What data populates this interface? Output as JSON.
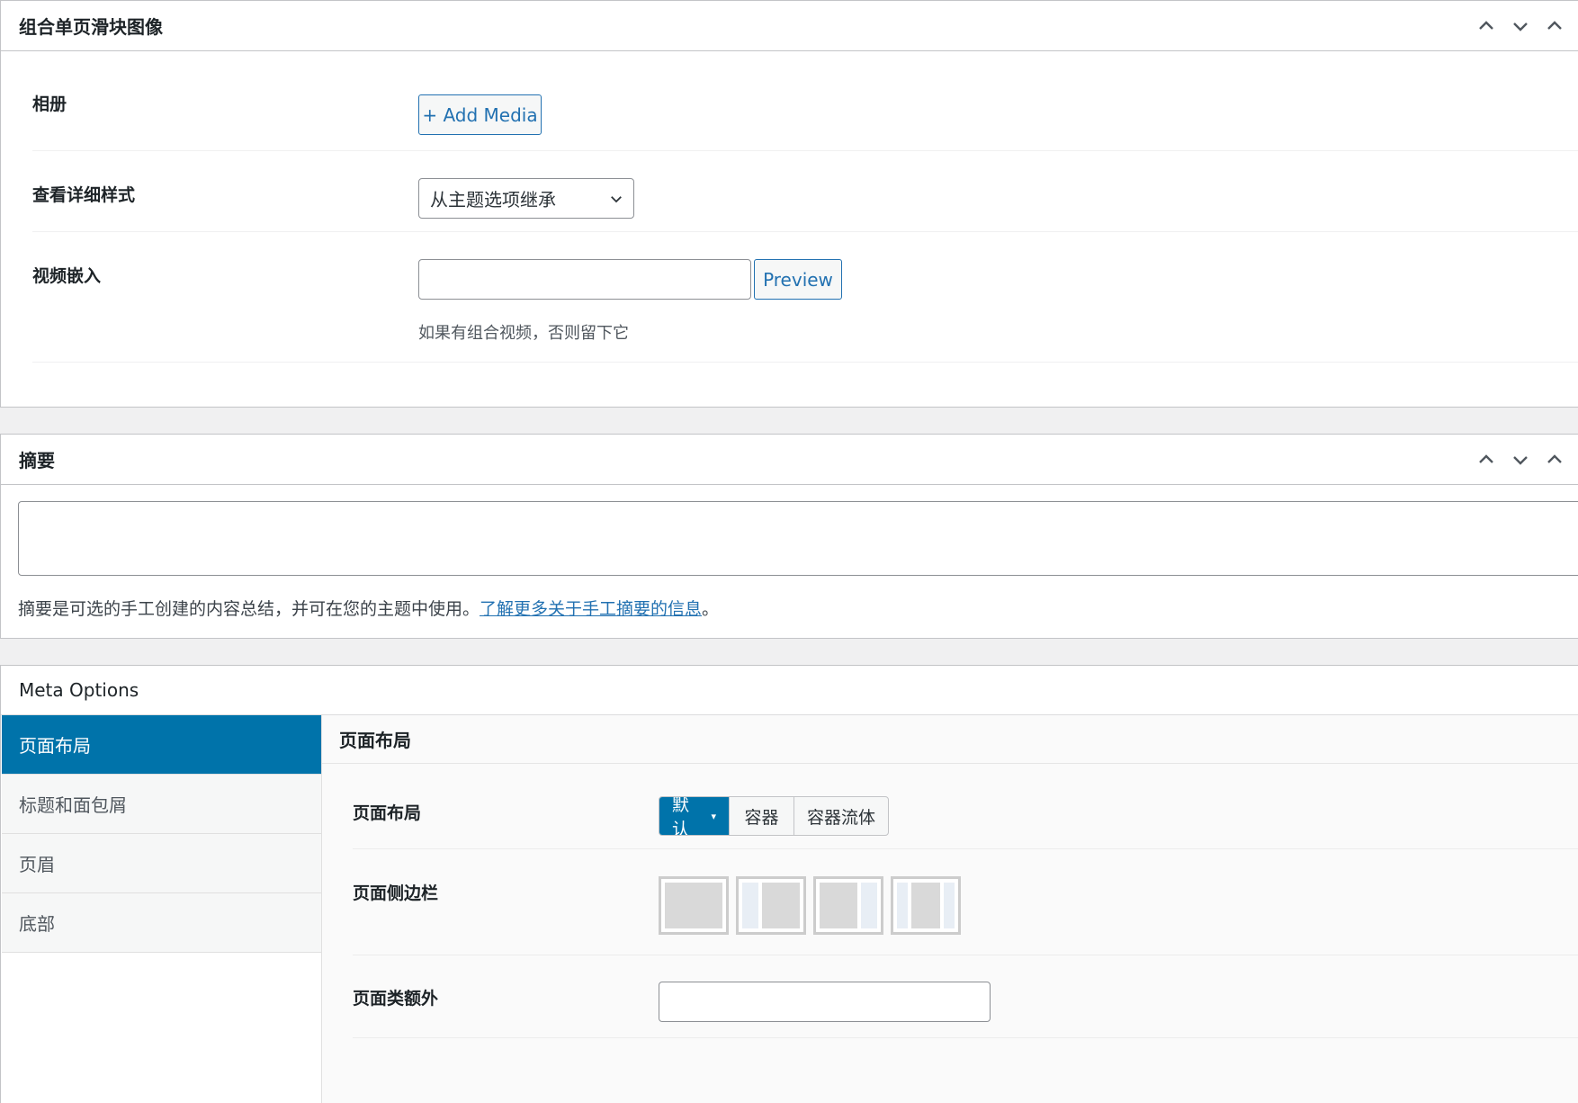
{
  "portfolio_box": {
    "title": "组合单页滑块图像",
    "fields": {
      "gallery_label": "相册",
      "add_media_label": "+ Add Media",
      "detail_style_label": "查看详细样式",
      "detail_style_value": "从主题选项继承",
      "video_label": "视频嵌入",
      "video_value": "",
      "preview_label": "Preview",
      "video_desc": "如果有组合视频，否则留下它"
    }
  },
  "excerpt_box": {
    "title": "摘要",
    "value": "",
    "desc_text": "摘要是可选的手工创建的内容总结，并可在您的主题中使用。",
    "desc_link": "了解更多关于手工摘要的信息",
    "desc_end": "。"
  },
  "meta_box": {
    "title": "Meta Options",
    "tabs": [
      {
        "label": "页面布局",
        "active": true
      },
      {
        "label": "标题和面包屑",
        "active": false
      },
      {
        "label": "页眉",
        "active": false
      },
      {
        "label": "底部",
        "active": false
      }
    ],
    "section_title": "页面布局",
    "layout_label": "页面布局",
    "layout_options": [
      "默认",
      "容器",
      "容器流体"
    ],
    "layout_selected": "默认",
    "sidebar_label": "页面侧边栏",
    "sidebar_options": [
      "no-sidebar",
      "left-sidebar",
      "right-sidebar",
      "both-sidebars"
    ],
    "extra_class_label": "页面类额外",
    "extra_class_value": ""
  },
  "colors": {
    "accent": "#0073aa",
    "link": "#2271b1",
    "border": "#c3c4c7"
  }
}
